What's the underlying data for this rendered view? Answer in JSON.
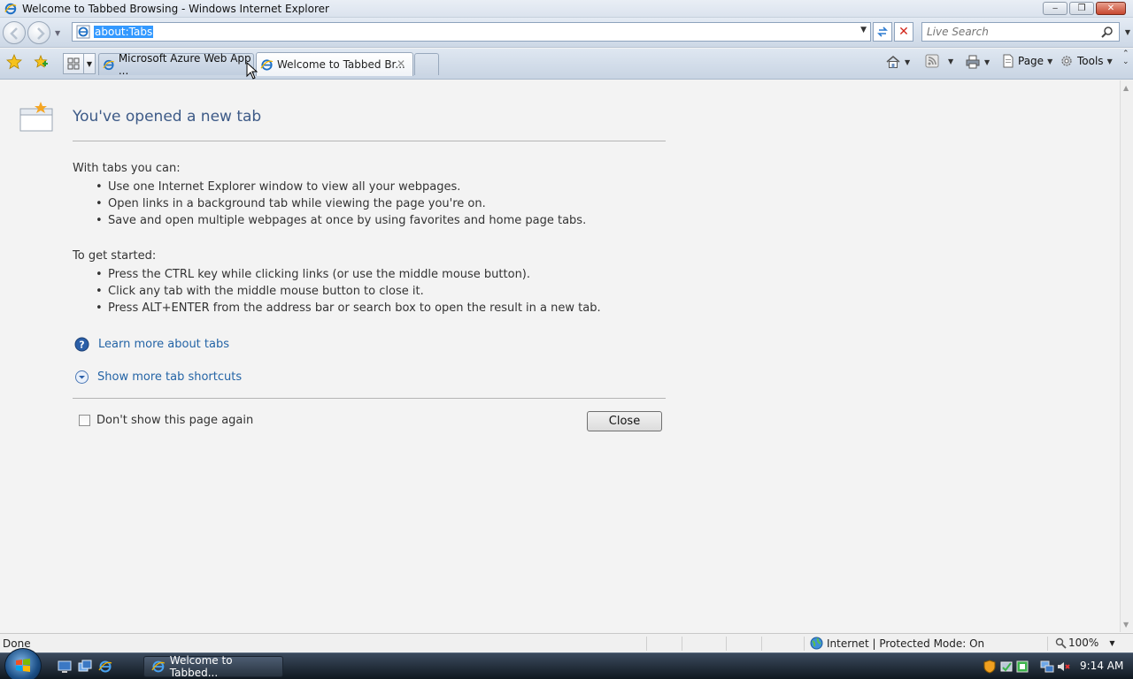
{
  "window": {
    "title": "Welcome to Tabbed Browsing - Windows Internet Explorer",
    "minimize_glyph": "‒",
    "maximize_glyph": "❐",
    "close_glyph": "✕"
  },
  "address_bar": {
    "url": "about:Tabs"
  },
  "search": {
    "placeholder": "Live Search"
  },
  "tabs": [
    {
      "label": "Microsoft Azure Web App ...",
      "state": "inactive"
    },
    {
      "label": "Welcome to Tabbed Br...",
      "state": "active"
    }
  ],
  "toolbar": {
    "page_label": "Page",
    "tools_label": "Tools"
  },
  "content": {
    "heading": "You've opened a new tab",
    "intro": "With tabs you can:",
    "tab_benefits": [
      "Use one Internet Explorer window to view all your webpages.",
      "Open links in a background tab while viewing the page you're on.",
      "Save and open multiple webpages at once by using favorites and home page tabs."
    ],
    "get_started": "To get started:",
    "get_started_items": [
      "Press the CTRL key while clicking links (or use the middle mouse button).",
      "Click any tab with the middle mouse button to close it.",
      "Press ALT+ENTER from the address bar or search box to open the result in a new tab."
    ],
    "learn_more_link": "Learn more about tabs",
    "shortcuts_link": "Show more tab shortcuts",
    "dont_show_label": "Don't show this page again",
    "close_button": "Close"
  },
  "status_bar": {
    "status": "Done",
    "zone": "Internet | Protected Mode: On",
    "zoom": "100%"
  },
  "taskbar": {
    "active_task": "Welcome to Tabbed...",
    "clock": "9:14 AM"
  },
  "colors": {
    "link": "#2464a6",
    "heading": "#3d5a87",
    "url_highlight": "#3399ff"
  }
}
